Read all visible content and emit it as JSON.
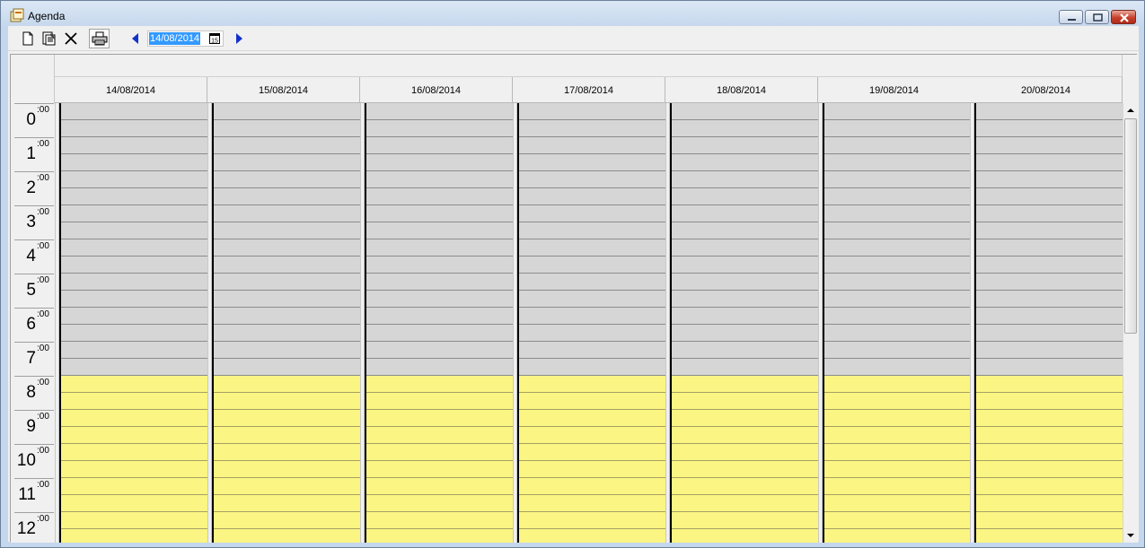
{
  "window": {
    "title": "Agenda"
  },
  "toolbar": {
    "date_value": "14/08/2014",
    "calendar_glyph": "15",
    "icons": [
      "new-document-icon",
      "edit-document-icon",
      "delete-icon",
      "print-icon",
      "previous-arrow-icon",
      "next-arrow-icon"
    ]
  },
  "days": [
    "14/08/2014",
    "15/08/2014",
    "16/08/2014",
    "17/08/2014",
    "18/08/2014",
    "19/08/2014",
    "20/08/2014"
  ],
  "hours": [
    {
      "hour": "0",
      "min": ":00"
    },
    {
      "hour": "1",
      "min": ":00"
    },
    {
      "hour": "2",
      "min": ":00"
    },
    {
      "hour": "3",
      "min": ":00"
    },
    {
      "hour": "4",
      "min": ":00"
    },
    {
      "hour": "5",
      "min": ":00"
    },
    {
      "hour": "6",
      "min": ":00"
    },
    {
      "hour": "7",
      "min": ":00"
    },
    {
      "hour": "8",
      "min": ":00"
    },
    {
      "hour": "9",
      "min": ":00"
    },
    {
      "hour": "10",
      "min": ":00"
    },
    {
      "hour": "11",
      "min": ":00"
    },
    {
      "hour": "12",
      "min": ":00"
    }
  ],
  "colors": {
    "off_hours": "#d6d6d6",
    "work_hours": "#fbf583",
    "selection": "#3399ff"
  }
}
